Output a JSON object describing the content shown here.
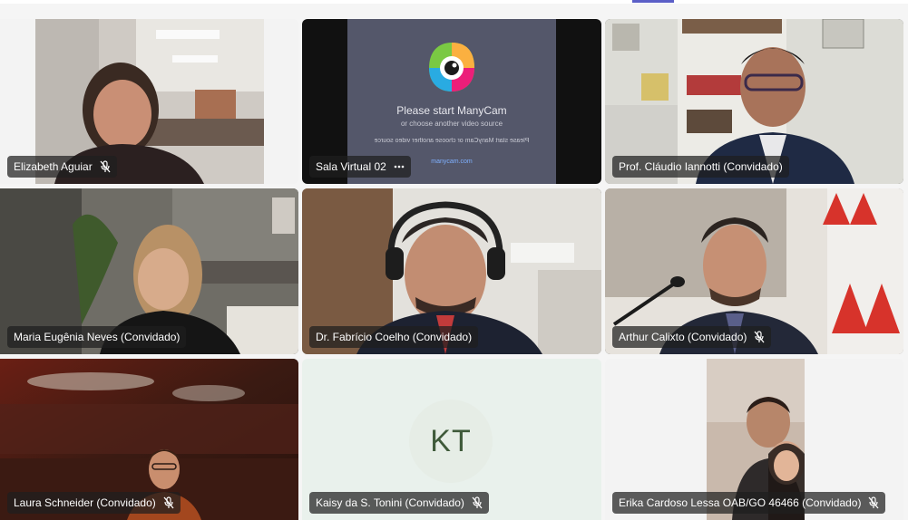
{
  "window": {
    "accent_color": "#5b5fc7"
  },
  "tiles": [
    {
      "name": "Elizabeth Aguiar",
      "status_icon": "mic-off-icon"
    },
    {
      "name": "Sala Virtual 02",
      "status_icon": "more-options-icon",
      "screen": {
        "title": "Please start ManyCam",
        "subtitle": "or choose another video source",
        "mirrored_text": "Please start ManyCam or choose another video source",
        "link": "manycam.com"
      }
    },
    {
      "name": "Prof. Cláudio Iannotti (Convidado)",
      "status_icon": "none"
    },
    {
      "name": "Maria Eugênia Neves (Convidado)",
      "status_icon": "none"
    },
    {
      "name": "Dr. Fabrício Coelho (Convidado)",
      "status_icon": "none"
    },
    {
      "name": "Arthur Calixto (Convidado)",
      "status_icon": "mic-off-icon"
    },
    {
      "name": "Laura Schneider (Convidado)",
      "status_icon": "mic-off-icon"
    },
    {
      "name": "Kaisy da S. Tonini (Convidado)",
      "status_icon": "mic-off-icon",
      "initials": "KT"
    },
    {
      "name": "Erika Cardoso Lessa OAB/GO 46466 (Convidado)",
      "status_icon": "mic-off-icon"
    }
  ]
}
